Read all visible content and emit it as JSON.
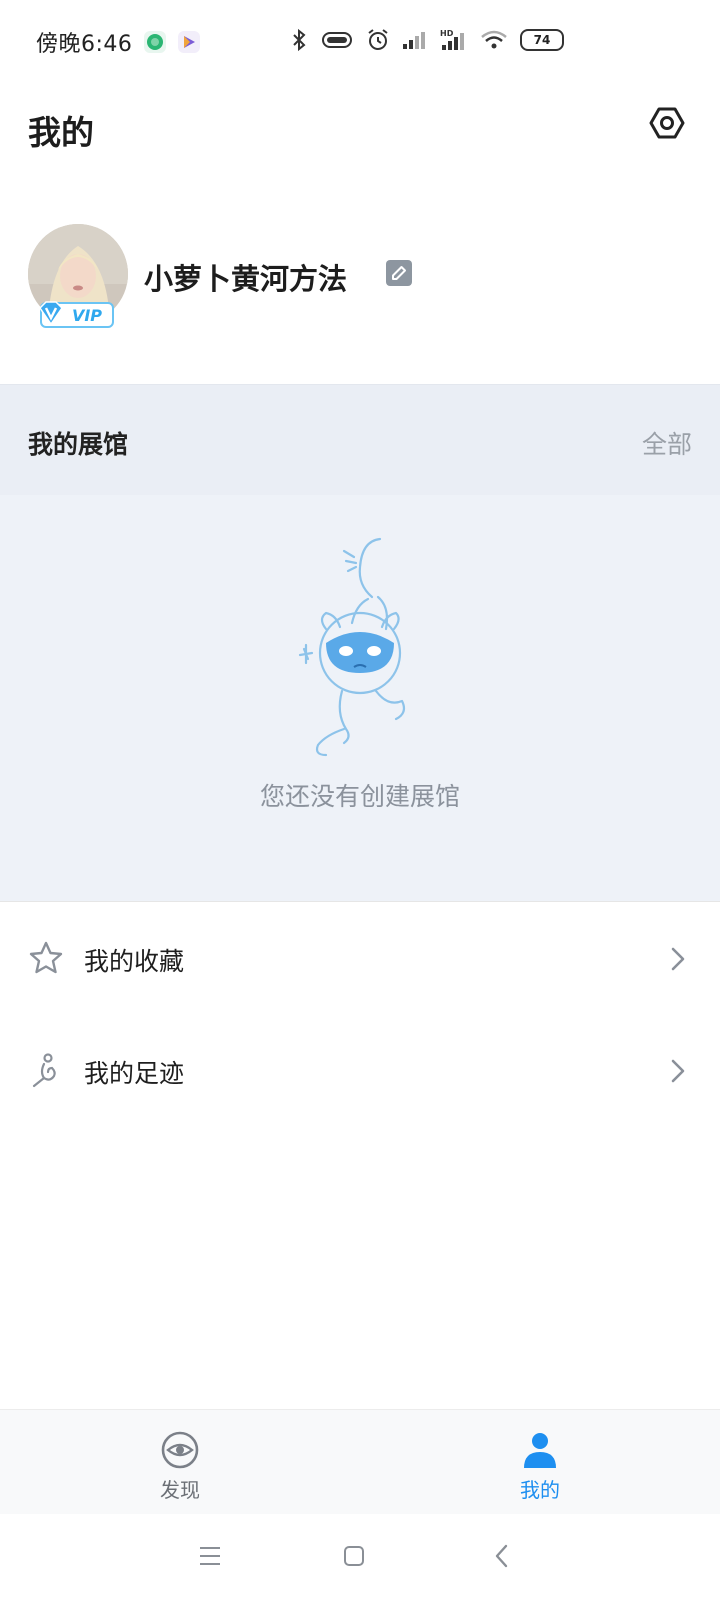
{
  "status_bar": {
    "time": "傍晚6:46",
    "battery": "74",
    "icons": [
      "app-green-icon",
      "play-store-icon",
      "bluetooth-icon",
      "vibrate-icon",
      "alarm-icon",
      "signal-icon",
      "hd-signal-icon",
      "wifi-icon",
      "battery-icon"
    ]
  },
  "header": {
    "title": "我的",
    "settings_icon": "settings-hexagon-icon"
  },
  "profile": {
    "username": "小萝卜黄河方法",
    "vip_label": "VIP",
    "edit_icon": "edit-icon"
  },
  "gallery": {
    "title": "我的展馆",
    "view_all": "全部",
    "empty_text": "您还没有创建展馆"
  },
  "menu": {
    "items": [
      {
        "label": "我的收藏",
        "icon": "star-icon"
      },
      {
        "label": "我的足迹",
        "icon": "footprint-icon"
      }
    ]
  },
  "tabbar": {
    "tabs": [
      {
        "label": "发现",
        "icon": "eye-icon",
        "active": false
      },
      {
        "label": "我的",
        "icon": "person-icon",
        "active": true
      }
    ]
  },
  "colors": {
    "accent": "#1e8ff0",
    "section_bg": "#eef2f8",
    "vip": "#2fa8ee",
    "muted_text": "#8b929c"
  }
}
